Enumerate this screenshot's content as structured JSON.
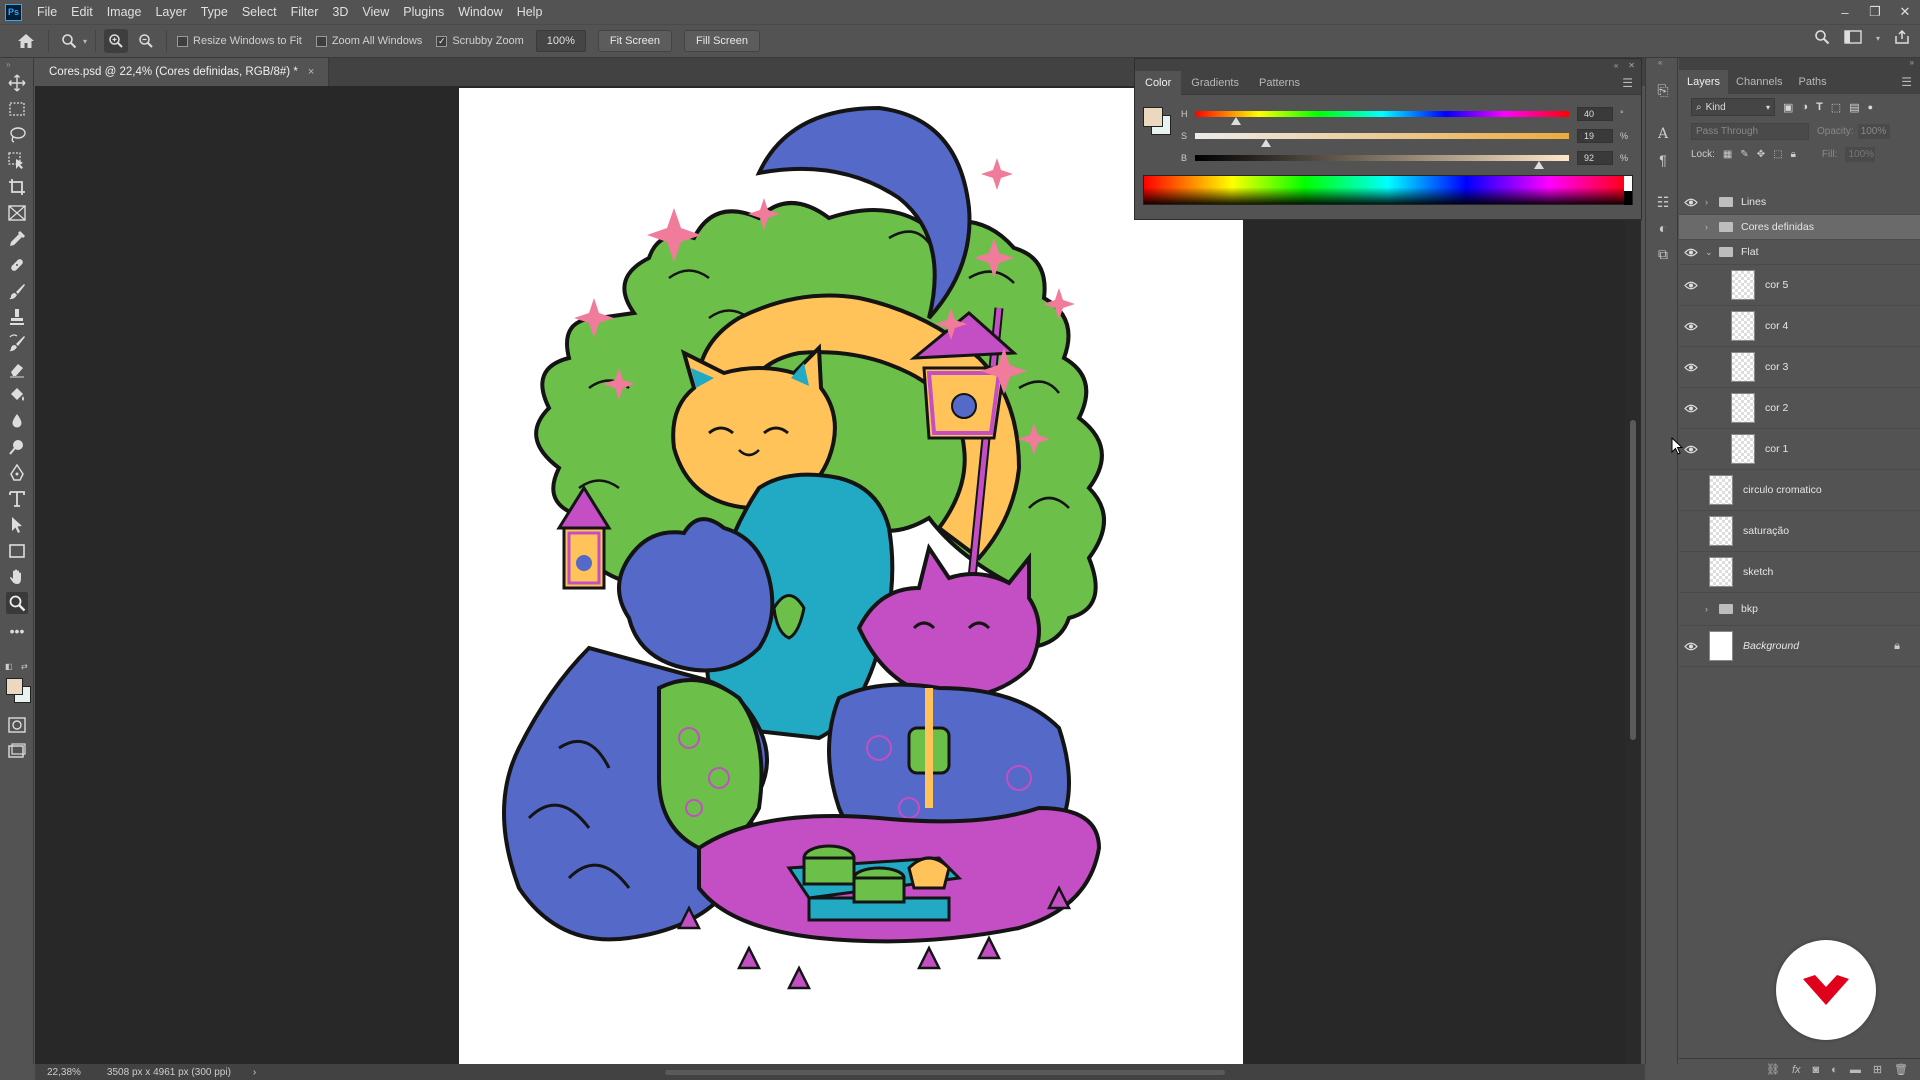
{
  "app": {
    "logo": "Ps",
    "menu": [
      "File",
      "Edit",
      "Image",
      "Layer",
      "Type",
      "Select",
      "Filter",
      "3D",
      "View",
      "Plugins",
      "Window",
      "Help"
    ]
  },
  "options_bar": {
    "resize_windows_label": "Resize Windows to Fit",
    "resize_windows_checked": false,
    "zoom_all_label": "Zoom All Windows",
    "zoom_all_checked": false,
    "scrubby_zoom_label": "Scrubby Zoom",
    "scrubby_zoom_checked": true,
    "zoom_value": "100%",
    "fit_screen_label": "Fit Screen",
    "fill_screen_label": "Fill Screen"
  },
  "document": {
    "tab_title": "Cores.psd @ 22,4% (Cores definidas, RGB/8#) *",
    "tab_close": "×"
  },
  "status": {
    "zoom": "22,38%",
    "doc_size": "3508 px x 4961 px (300 ppi)",
    "arrow": "›"
  },
  "color_panel": {
    "tabs": [
      "Color",
      "Gradients",
      "Patterns"
    ],
    "active_tab": "Color",
    "h_label": "H",
    "h_value": "40",
    "h_unit": "°",
    "h_pos": 0.11,
    "s_label": "S",
    "s_value": "19",
    "s_unit": "%",
    "s_pos": 0.19,
    "b_label": "B",
    "b_value": "92",
    "b_unit": "%",
    "b_pos": 0.92,
    "fg_color": "#ebd8be",
    "bg_color": "#e8f2f0"
  },
  "toolbar": {
    "fg_color": "#ebd8be",
    "bg_color": "#e8f2f0"
  },
  "layers_panel": {
    "tabs": [
      "Layers",
      "Channels",
      "Paths"
    ],
    "active_tab": "Layers",
    "kind_label": "Kind",
    "blend_mode": "Pass Through",
    "opacity_label": "Opacity:",
    "opacity_value": "100%",
    "lock_label": "Lock:",
    "fill_label": "Fill:",
    "fill_value": "100%",
    "layers": [
      {
        "name": "Lines",
        "type": "group",
        "visible": true,
        "expanded": false,
        "selected": false
      },
      {
        "name": "Cores definidas",
        "type": "group",
        "visible": false,
        "expanded": false,
        "selected": true
      },
      {
        "name": "Flat",
        "type": "group",
        "visible": true,
        "expanded": true,
        "selected": false
      },
      {
        "name": "cor 5",
        "type": "layer",
        "visible": true,
        "indent": true
      },
      {
        "name": "cor 4",
        "type": "layer",
        "visible": true,
        "indent": true
      },
      {
        "name": "cor 3",
        "type": "layer",
        "visible": true,
        "indent": true
      },
      {
        "name": "cor 2",
        "type": "layer",
        "visible": true,
        "indent": true
      },
      {
        "name": "cor 1",
        "type": "layer",
        "visible": true,
        "indent": true
      },
      {
        "name": "circulo cromatico",
        "type": "layer",
        "visible": false
      },
      {
        "name": "saturação",
        "type": "layer",
        "visible": false
      },
      {
        "name": "sketch",
        "type": "layer",
        "visible": false
      },
      {
        "name": "bkp",
        "type": "group",
        "visible": false,
        "expanded": false
      },
      {
        "name": "Background",
        "type": "background",
        "visible": true,
        "locked": true
      }
    ]
  },
  "colors": {
    "moon_blue": "#5469c8",
    "cat_orange": "#ffc35a",
    "smoke_green": "#6cc04a",
    "cat_purple": "#c44ec4",
    "teal": "#22a9c4",
    "accent_red": "#e0001b"
  }
}
